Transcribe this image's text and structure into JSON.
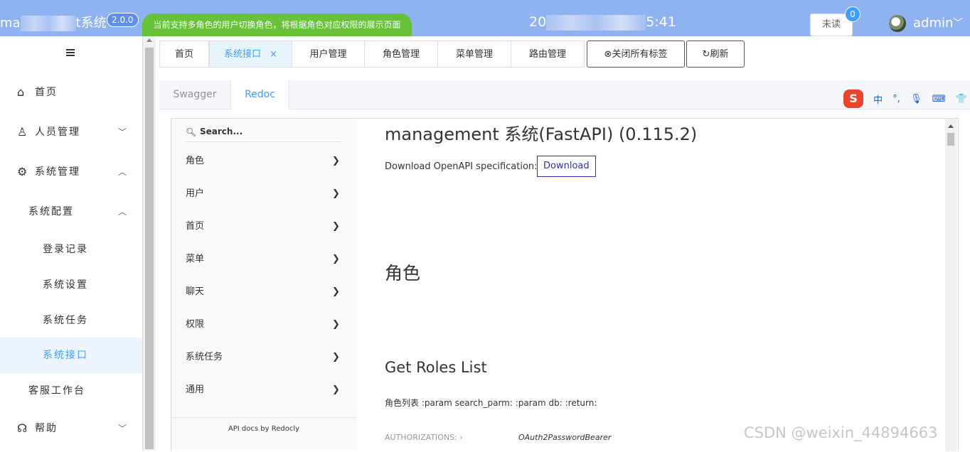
{
  "header": {
    "app_title_start": "ma",
    "app_title_end": "t系统",
    "version": "2.0.0",
    "notice": "当前支持多角色的用户切换角色，将根据角色对应权限的展示页面",
    "clock_start": "20",
    "clock_end": "5:41",
    "unread_label": "未读",
    "unread_count": "0",
    "username": "admin"
  },
  "sidebar": {
    "items": [
      {
        "label": "首页",
        "icon": "home-icon"
      },
      {
        "label": "人员管理",
        "icon": "user-icon"
      },
      {
        "label": "系统管理",
        "icon": "gear-icon"
      },
      {
        "label": "系统配置"
      },
      {
        "label": "登录记录"
      },
      {
        "label": "系统设置"
      },
      {
        "label": "系统任务"
      },
      {
        "label": "系统接口"
      },
      {
        "label": "客服工作台"
      },
      {
        "label": "帮助",
        "icon": "headset-icon"
      }
    ]
  },
  "tags": {
    "items": [
      "首页",
      "系统接口",
      "用户管理",
      "角色管理",
      "菜单管理",
      "路由管理"
    ],
    "close_all": "关闭所有标签",
    "refresh": "刷新"
  },
  "doc_tabs": [
    "Swagger",
    "Redoc"
  ],
  "ime": {
    "logo": "S",
    "glyphs": [
      "中",
      "°,",
      "🎙",
      "⌨",
      "👕",
      "▦"
    ]
  },
  "redoc": {
    "search_placeholder": "Search...",
    "nav": [
      "角色",
      "用户",
      "首页",
      "菜单",
      "聊天",
      "权限",
      "系统任务",
      "通用"
    ],
    "powered_by": "API docs by Redocly",
    "title": "management 系统(FastAPI) (0.115.2)",
    "download_label": "Download OpenAPI specification:",
    "download_button": "Download",
    "section": "角色",
    "operation_title": "Get Roles List",
    "operation_desc": "角色列表 :param search_parm: :param db: :return:",
    "auth_label": "AUTHORIZATIONS:",
    "auth_value": "OAuth2PasswordBearer"
  },
  "watermark": "CSDN @weixin_44894663"
}
